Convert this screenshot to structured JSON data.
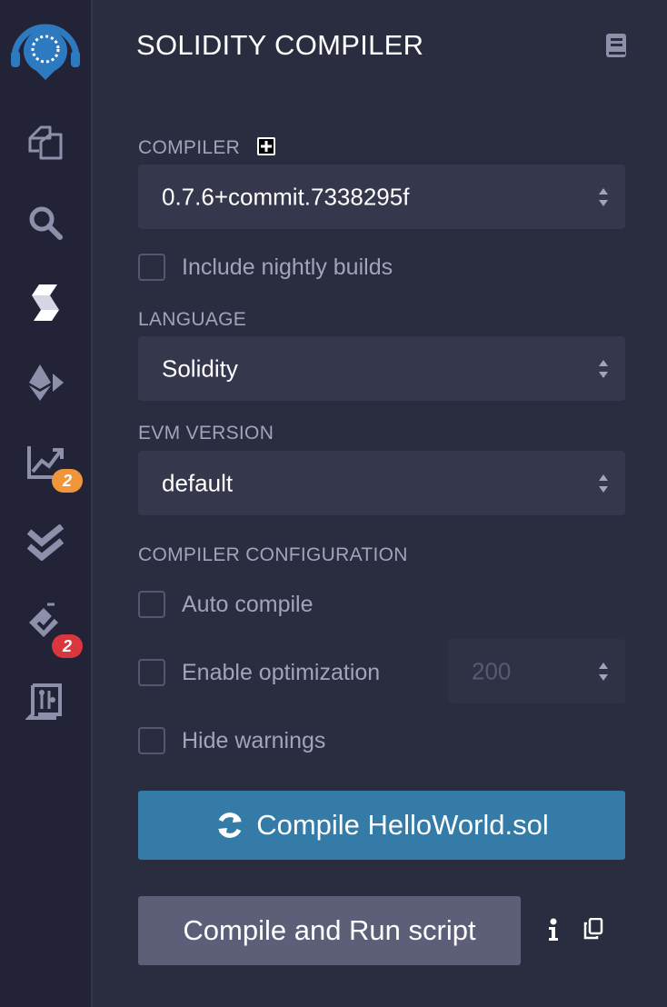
{
  "iconbar": {
    "items": [
      {
        "icon": "remix-logo-icon"
      },
      {
        "icon": "file-explorer-icon"
      },
      {
        "icon": "search-icon"
      },
      {
        "icon": "solidity-compiler-icon"
      },
      {
        "icon": "deploy-run-icon"
      },
      {
        "icon": "analysis-chart-icon",
        "badge": "2",
        "badge_color": "#f0953a"
      },
      {
        "icon": "double-check-icon"
      },
      {
        "icon": "verify-check-icon",
        "badge": "2",
        "badge_color": "#d9363e"
      },
      {
        "icon": "circuit-plugin-icon"
      }
    ]
  },
  "panel": {
    "title": "SOLIDITY COMPILER",
    "compiler_label": "COMPILER",
    "compiler_value": "0.7.6+commit.7338295f",
    "nightly_label": "Include nightly builds",
    "language_label": "LANGUAGE",
    "language_value": "Solidity",
    "evm_label": "EVM VERSION",
    "evm_value": "default",
    "config_label": "COMPILER CONFIGURATION",
    "auto_compile_label": "Auto compile",
    "optimization_label": "Enable optimization",
    "optimization_runs": "200",
    "hide_warnings_label": "Hide warnings",
    "compile_button": "Compile HelloWorld.sol",
    "run_script_button": "Compile and Run script"
  },
  "colors": {
    "accent": "#357ba8",
    "secondary_button": "#5d5f78",
    "background": "#2a2c3f",
    "sidebar": "#222336"
  }
}
